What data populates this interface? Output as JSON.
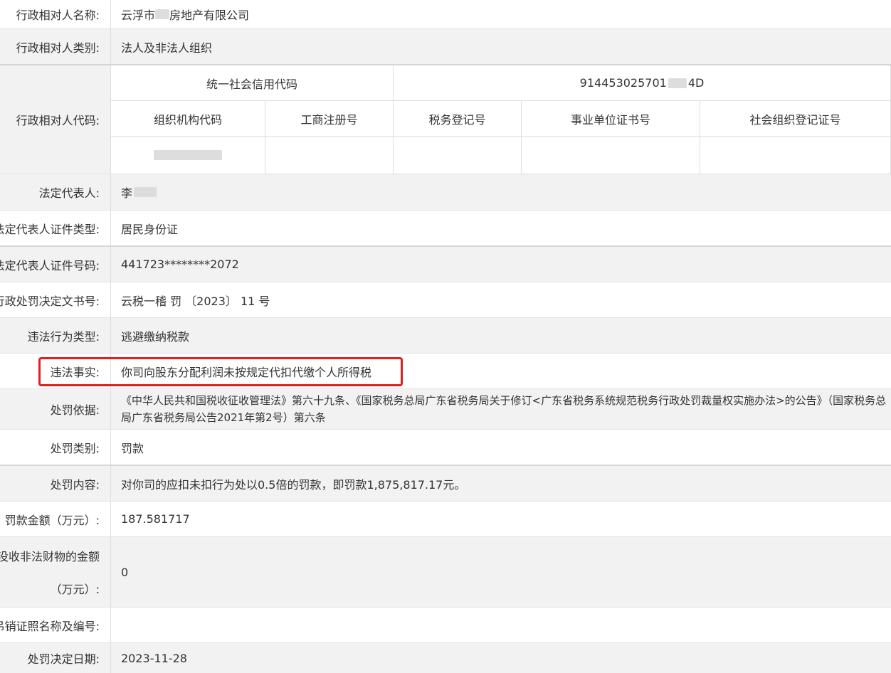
{
  "rows": {
    "name": {
      "label": "行政相对人名称:",
      "value_prefix": "云浮市",
      "value_suffix": "房地产有限公司"
    },
    "category": {
      "label": "行政相对人类别:",
      "value": "法人及非法人组织"
    },
    "code": {
      "label": "行政相对人代码:",
      "credit_code_header": "统一社会信用代码",
      "credit_code_value_prefix": "914453025701",
      "credit_code_value_suffix": "4D",
      "headers": [
        "组织机构代码",
        "工商注册号",
        "税务登记号",
        "事业单位证书号",
        "社会组织登记证号"
      ]
    },
    "legal_rep": {
      "label": "法定代表人:",
      "value": "李"
    },
    "id_type": {
      "label": "法定代表人证件类型:",
      "value": "居民身份证"
    },
    "id_number": {
      "label": "法定代表人证件号码:",
      "value": "441723********2072"
    },
    "doc_no": {
      "label": "行政处罚决定文书号:",
      "value": "云税一稽 罚 〔2023〕 11 号"
    },
    "violation_type": {
      "label": "违法行为类型:",
      "value": "逃避缴纳税款"
    },
    "violation_fact": {
      "label": "违法事实:",
      "value": "你司向股东分配利润未按规定代扣代缴个人所得税"
    },
    "basis": {
      "label": "处罚依据:",
      "value": "《中华人民共和国税收征收管理法》第六十九条、《国家税务总局广东省税务局关于修订<广东省税务系统规范税务行政处罚裁量权实施办法>的公告》（国家税务总局广东省税务局公告2021年第2号）第六条"
    },
    "penalty_type": {
      "label": "处罚类别:",
      "value": "罚款"
    },
    "penalty_content": {
      "label": "处罚内容:",
      "value": "对你司的应扣未扣行为处以0.5倍的罚款，即罚款1,875,817.17元。"
    },
    "fine_amount": {
      "label": "罚款金额（万元）:",
      "value": "187.581717"
    },
    "confiscation": {
      "label_line1": "没收非法财物的金额",
      "label_line2": "（万元）:",
      "value": "0"
    },
    "revoke": {
      "label": "暂扣或吊销证照名称及编号:",
      "value": ""
    },
    "decision_date": {
      "label": "处罚决定日期:",
      "value": "2023-11-28"
    }
  },
  "colors": {
    "highlight_border": "#e02020",
    "alt_row": "#f2f2f2",
    "border": "#dddddd"
  }
}
